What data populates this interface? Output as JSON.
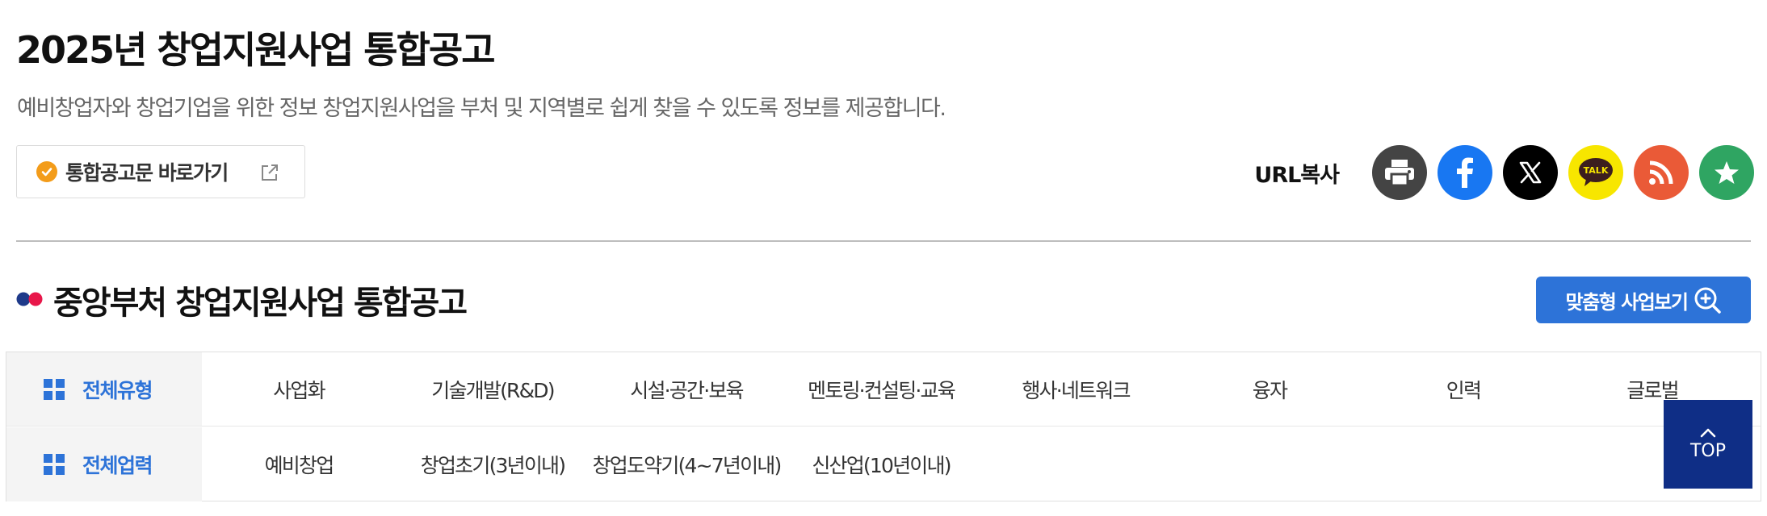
{
  "header": {
    "title": "2025년 창업지원사업 통합공고",
    "description": "예비창업자와 창업기업을 위한 정보 창업지원사업을 부처 및 지역별로 쉽게 찾을 수 있도록 정보를 제공합니다."
  },
  "notice_link": {
    "label": "통합공고문 바로가기",
    "icons": [
      "check-circle-icon",
      "external-link-icon"
    ]
  },
  "share": {
    "url_copy_label": "URL복사",
    "buttons": [
      {
        "name": "print",
        "icon": "printer-icon",
        "color": "#444444"
      },
      {
        "name": "facebook",
        "icon": "facebook-icon",
        "color": "#1877f2"
      },
      {
        "name": "x",
        "icon": "x-icon",
        "color": "#000000"
      },
      {
        "name": "kakaotalk",
        "icon": "kakaotalk-icon",
        "color": "#f7e600",
        "text": "TALK"
      },
      {
        "name": "rss",
        "icon": "rss-icon",
        "color": "#ea5a37"
      },
      {
        "name": "favorite",
        "icon": "star-icon",
        "color": "#2fa562"
      }
    ]
  },
  "section": {
    "title": "중앙부처 창업지원사업 통합공고",
    "dot_colors": [
      "#1e3a8a",
      "#e8174a"
    ]
  },
  "custom_button": {
    "label": "맞춤형 사업보기",
    "icon": "zoom-in-icon"
  },
  "filter": {
    "type_row": {
      "head": "전체유형",
      "options": [
        "사업화",
        "기술개발(R&D)",
        "시설·공간·보육",
        "멘토링·컨설팅·교육",
        "행사·네트워크",
        "융자",
        "인력",
        "글로벌"
      ]
    },
    "career_row": {
      "head": "전체업력",
      "options": [
        "예비창업",
        "창업초기(3년이내)",
        "창업도약기(4~7년이내)",
        "신산업(10년이내)"
      ]
    }
  },
  "top_button": {
    "label": "TOP",
    "icon": "chevron-up-icon"
  },
  "colors": {
    "accent": "#2d73d8",
    "top_button": "#0f2e86"
  }
}
